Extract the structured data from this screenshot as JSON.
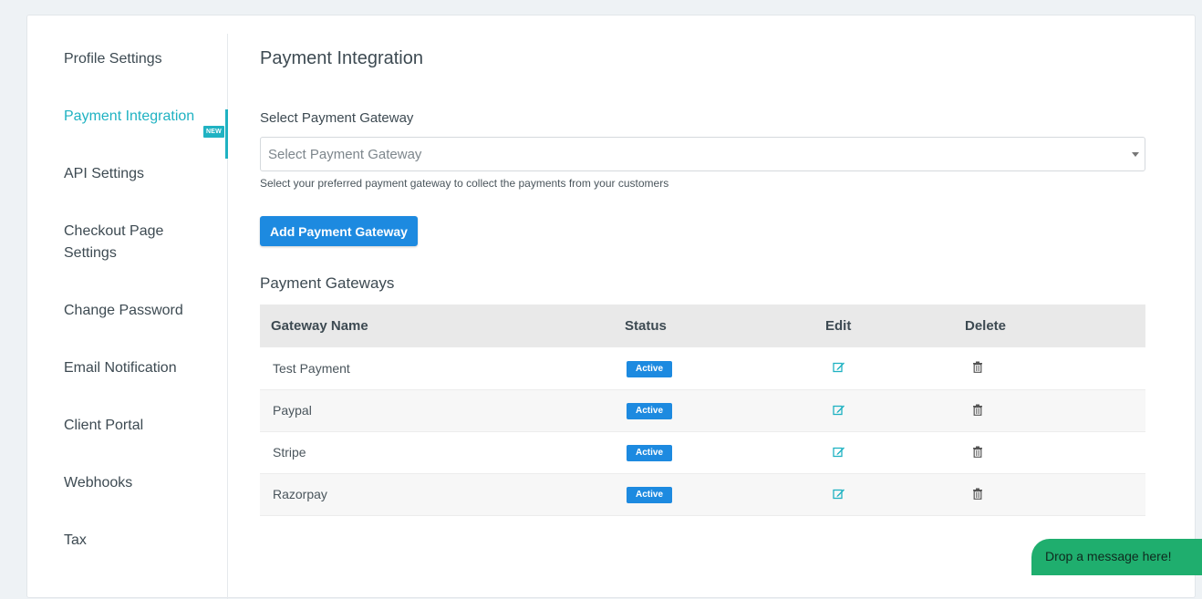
{
  "sidebar": {
    "items": [
      {
        "label": "Profile Settings"
      },
      {
        "label": "Payment Integration",
        "badge": "NEW"
      },
      {
        "label": "API Settings"
      },
      {
        "label": "Checkout Page Settings"
      },
      {
        "label": "Change Password"
      },
      {
        "label": "Email Notification"
      },
      {
        "label": "Client Portal"
      },
      {
        "label": "Webhooks"
      },
      {
        "label": "Tax"
      }
    ],
    "active_index": 1
  },
  "main": {
    "title": "Payment Integration",
    "gateway_select": {
      "label": "Select Payment Gateway",
      "placeholder": "Select Payment Gateway",
      "help": "Select your preferred payment gateway to collect the payments from your customers"
    },
    "add_button": "Add Payment Gateway",
    "gateways_title": "Payment Gateways",
    "table": {
      "headers": [
        "Gateway Name",
        "Status",
        "Edit",
        "Delete"
      ],
      "rows": [
        {
          "name": "Test Payment",
          "status": "Active"
        },
        {
          "name": "Paypal",
          "status": "Active"
        },
        {
          "name": "Stripe",
          "status": "Active"
        },
        {
          "name": "Razorpay",
          "status": "Active"
        }
      ],
      "edit_icon": "edit-icon",
      "delete_icon": "trash-icon"
    }
  },
  "chat_widget": {
    "label": "Drop a message here!"
  },
  "colors": {
    "accent": "#1fb2c2",
    "primary_button": "#1d8ae0",
    "chat": "#1fae6e"
  }
}
